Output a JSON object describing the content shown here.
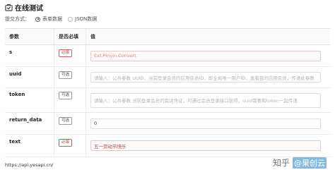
{
  "header": {
    "title": "在线测试"
  },
  "submit": {
    "label": "提交方式：",
    "options": [
      {
        "label": "表单数据",
        "checked": true
      },
      {
        "label": "JSON数据",
        "checked": false
      }
    ]
  },
  "table": {
    "columns": [
      "参数",
      "是否必填",
      "值"
    ],
    "rows": [
      {
        "name": "s",
        "required": "必填",
        "value": "Ext.Pinyin.Convert"
      },
      {
        "name": "uuid",
        "required": "可选",
        "placeholder": "请输入：公共参数 UUID，当前登录会员的应用会员ID，即全局唯一用户ID，查看我的应用会员，传递此参数"
      },
      {
        "name": "token",
        "required": "可选",
        "placeholder": "请输入：公共参数 当前登录会员的会话凭证，可通过会员登录接口获得，uuid需要和token一起传递"
      },
      {
        "name": "return_data",
        "required": "可选",
        "value": "0"
      },
      {
        "name": "text",
        "required": "必填",
        "value": "五一劳动节快乐"
      }
    ]
  },
  "footer": {
    "url": "https://api.yesapi.cn/"
  },
  "watermark": {
    "text": "知乎",
    "handle": "@果创云"
  }
}
